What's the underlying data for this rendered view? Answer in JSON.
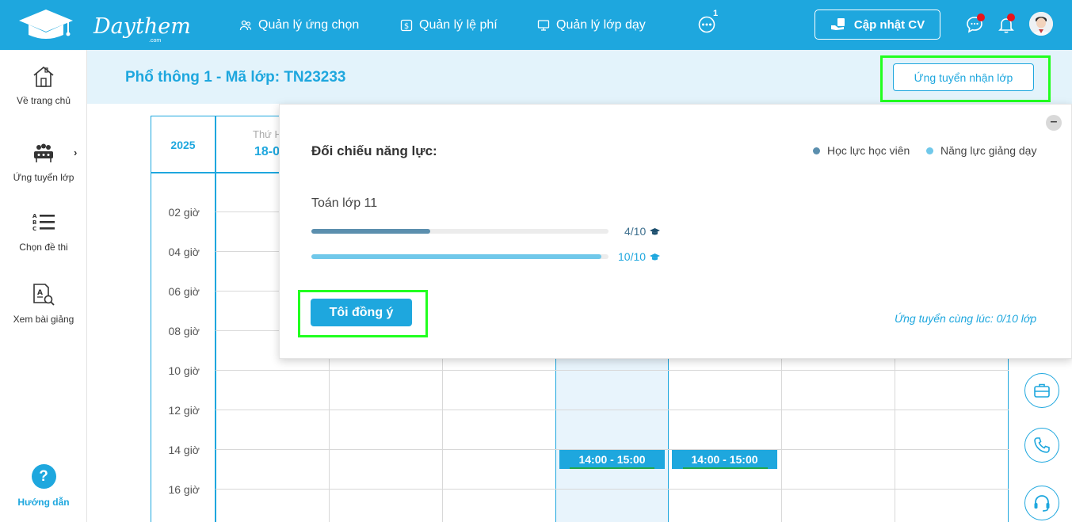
{
  "brand": {
    "name": "Daythem",
    "domain_suffix": ".com"
  },
  "nav": {
    "items": [
      {
        "label": "Quản lý ứng chọn",
        "icon": "users-icon"
      },
      {
        "label": "Quản lý lệ phí",
        "icon": "dollar-icon"
      },
      {
        "label": "Quản lý lớp dạy",
        "icon": "monitor-icon"
      }
    ],
    "more_badge": "1",
    "update_cv_label": "Cập nhật CV"
  },
  "sidebar": {
    "items": [
      {
        "label": "Về trang chủ",
        "icon": "home-icon"
      },
      {
        "label": "Ứng tuyển lớp",
        "icon": "class-group-icon"
      },
      {
        "label": "Chọn đề thi",
        "icon": "abc-list-icon"
      },
      {
        "label": "Xem bài giảng",
        "icon": "document-search-icon"
      }
    ],
    "help_label": "Hướng dẫn",
    "help_icon": "?"
  },
  "header": {
    "class_title": "Phổ thông 1 - Mã lớp: TN23233",
    "apply_button": "Ứng tuyển nhận lớp"
  },
  "calendar": {
    "year": "2025",
    "first_day_sub": "Thứ H",
    "first_day_date": "18-0",
    "hours": [
      "02 giờ",
      "04 giờ",
      "06 giờ",
      "08 giờ",
      "10 giờ",
      "12 giờ",
      "14 giờ",
      "16 giờ"
    ],
    "slots": [
      "14:00 - 15:00",
      "14:00 - 15:00"
    ]
  },
  "popup": {
    "title": "Đối chiếu năng lực:",
    "legend": [
      {
        "label": "Học lực học viên",
        "color": "#5b8fae"
      },
      {
        "label": "Năng lực giảng dạy",
        "color": "#70c8ea"
      }
    ],
    "subject": "Toán lớp 11",
    "student_score": {
      "text": "4/10",
      "fraction": 0.4,
      "color": "#5b8fae"
    },
    "teacher_score": {
      "text": "10/10",
      "fraction": 1.0,
      "color": "#70c8ea"
    },
    "agree_button": "Tôi đồng ý",
    "simultaneous_note": "Ứng tuyển cùng lúc: 0/10 lớp",
    "close_symbol": "–"
  },
  "colors": {
    "primary": "#1ea7de",
    "highlight": "#21ff1f",
    "badge_red": "#e8141a"
  }
}
